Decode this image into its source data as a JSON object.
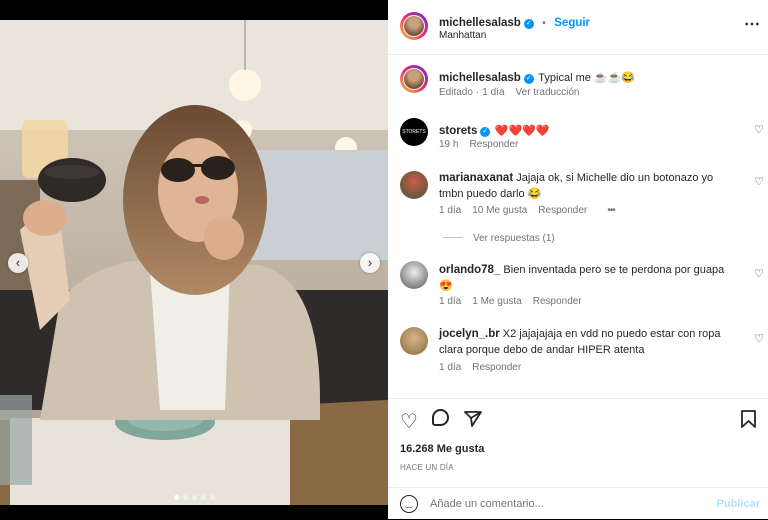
{
  "header": {
    "username": "michellesalasb",
    "separator": "•",
    "follow": "Seguir",
    "location": "Manhattan",
    "more": "⋯"
  },
  "caption": {
    "username": "michellesalasb",
    "text": "Typical me ☕☕😂",
    "edited": "Editado",
    "time": "1 día",
    "translate": "Ver traducción"
  },
  "comments": [
    {
      "username": "storets",
      "text": "❤️❤️❤️❤️",
      "time": "19 h",
      "reply": "Responder"
    },
    {
      "username": "marianaxanat",
      "text": "Jajaja ok, si Michelle dio un botonazo yo tmbn puedo darlo 😂",
      "time": "1 día",
      "likes": "10 Me gusta",
      "reply": "Responder",
      "more": "•••",
      "view_replies": "Ver respuestas (1)"
    },
    {
      "username": "orlando78_",
      "text": "Bien inventada pero se te perdona por guapa 😍",
      "time": "1 día",
      "likes": "1 Me gusta",
      "reply": "Responder"
    },
    {
      "username": "jocelyn_.br",
      "text": "X2 jajajajaja en vdd no puedo estar con ropa clara porque debo de andar HIPER atenta",
      "time": "1 día",
      "reply": "Responder"
    }
  ],
  "stats": {
    "likes": "16.268 Me gusta",
    "time": "HACE UN DÍA"
  },
  "add_comment": {
    "placeholder": "Añade un comentario...",
    "publish": "Publicar"
  },
  "carousel": {
    "slides": 5,
    "active": 0
  }
}
